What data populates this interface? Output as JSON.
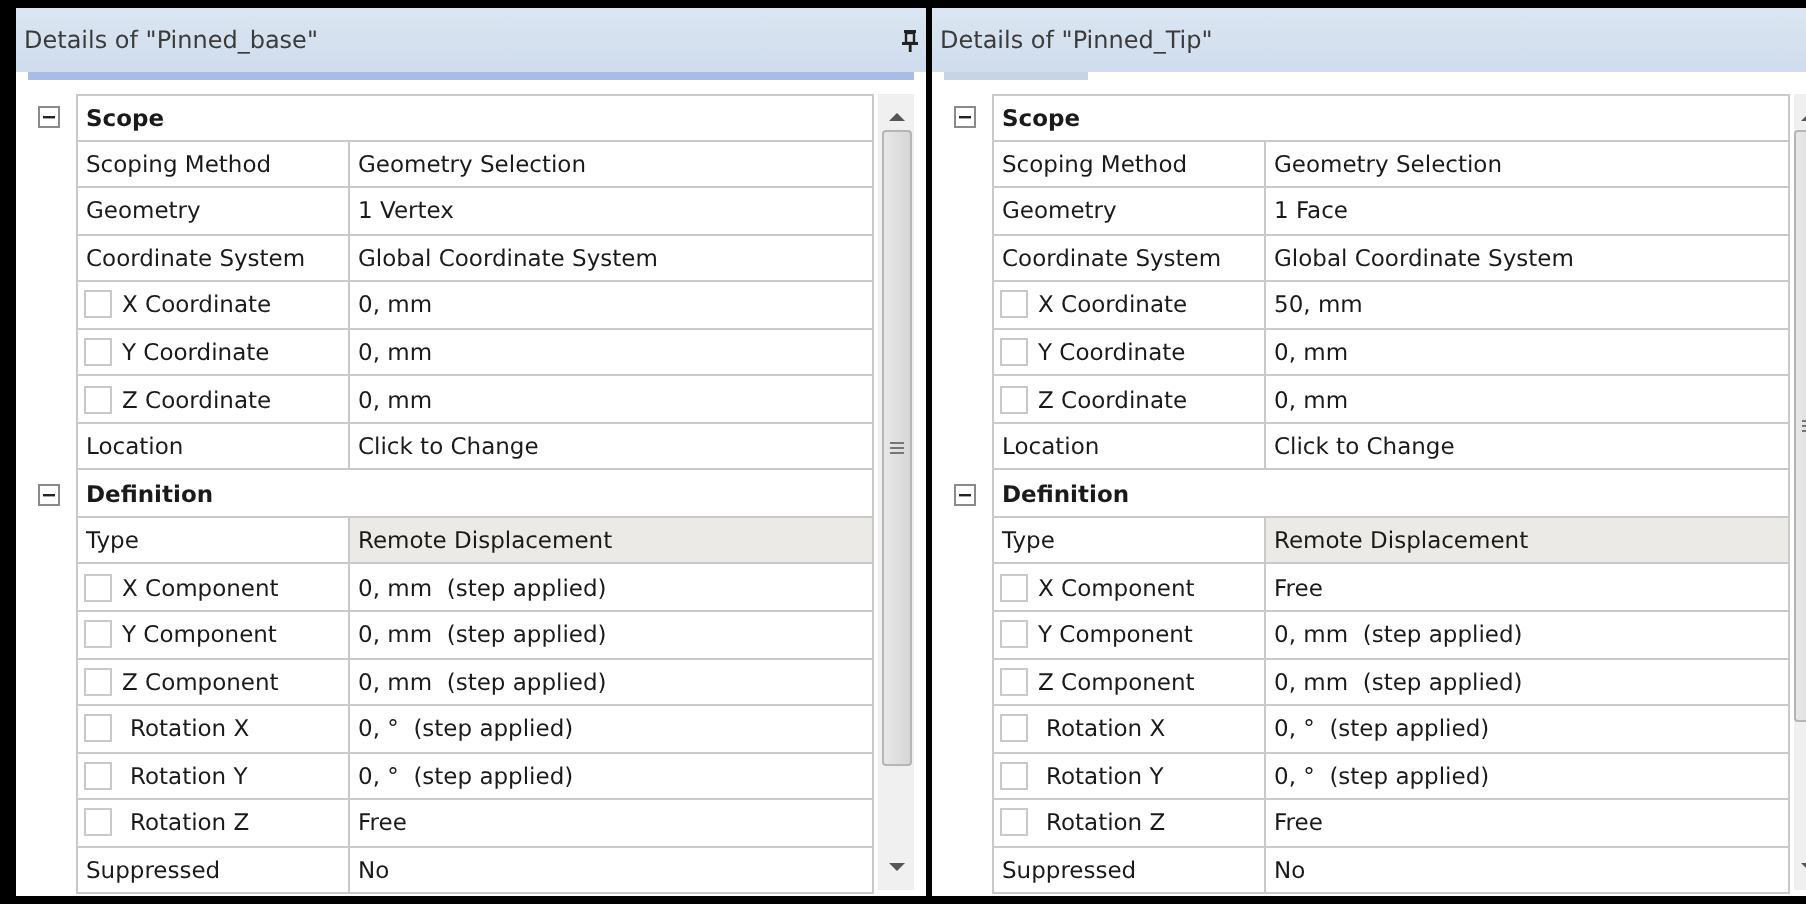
{
  "panels": [
    {
      "title": "Details of \"Pinned_base\"",
      "pinned": true,
      "sections": [
        {
          "label": "Scope",
          "expanded": true,
          "rows": [
            {
              "kind": "plain",
              "name": "Scoping Method",
              "value": "Geometry Selection",
              "shaded": false
            },
            {
              "kind": "plain",
              "name": "Geometry",
              "value": "1 Vertex",
              "shaded": false
            },
            {
              "kind": "plain",
              "name": "Coordinate System",
              "value": "Global Coordinate System",
              "shaded": false
            },
            {
              "kind": "checkbox",
              "name": "X Coordinate",
              "value": "0, mm",
              "shaded": false,
              "checked": false
            },
            {
              "kind": "checkbox",
              "name": "Y Coordinate",
              "value": "0, mm",
              "shaded": false,
              "checked": false
            },
            {
              "kind": "checkbox",
              "name": "Z Coordinate",
              "value": "0, mm",
              "shaded": false,
              "checked": false
            },
            {
              "kind": "plain",
              "name": "Location",
              "value": "Click to Change",
              "shaded": false
            }
          ]
        },
        {
          "label": "Definition",
          "expanded": true,
          "rows": [
            {
              "kind": "plain",
              "name": "Type",
              "value": "Remote Displacement",
              "shaded": true
            },
            {
              "kind": "checkbox",
              "name": "X Component",
              "value": "0, mm  (step applied)",
              "shaded": false,
              "checked": false
            },
            {
              "kind": "checkbox",
              "name": "Y Component",
              "value": "0, mm  (step applied)",
              "shaded": false,
              "checked": false
            },
            {
              "kind": "checkbox",
              "name": "Z Component",
              "value": "0, mm  (step applied)",
              "shaded": false,
              "checked": false
            },
            {
              "kind": "indented",
              "name": "Rotation X",
              "value": "0, °  (step applied)",
              "shaded": false,
              "checked": false
            },
            {
              "kind": "indented",
              "name": "Rotation Y",
              "value": "0, °  (step applied)",
              "shaded": false,
              "checked": false
            },
            {
              "kind": "indented",
              "name": "Rotation Z",
              "value": "Free",
              "shaded": false,
              "checked": false
            },
            {
              "kind": "plain",
              "name": "Suppressed",
              "value": "No",
              "shaded": false
            }
          ]
        }
      ]
    },
    {
      "title": "Details of \"Pinned_Tip\"",
      "pinned": false,
      "sections": [
        {
          "label": "Scope",
          "expanded": true,
          "rows": [
            {
              "kind": "plain",
              "name": "Scoping Method",
              "value": "Geometry Selection",
              "shaded": false
            },
            {
              "kind": "plain",
              "name": "Geometry",
              "value": "1 Face",
              "shaded": false
            },
            {
              "kind": "plain",
              "name": "Coordinate System",
              "value": "Global Coordinate System",
              "shaded": false
            },
            {
              "kind": "checkbox",
              "name": "X Coordinate",
              "value": "50, mm",
              "shaded": false,
              "checked": false
            },
            {
              "kind": "checkbox",
              "name": "Y Coordinate",
              "value": "0, mm",
              "shaded": false,
              "checked": false
            },
            {
              "kind": "checkbox",
              "name": "Z Coordinate",
              "value": "0, mm",
              "shaded": false,
              "checked": false
            },
            {
              "kind": "plain",
              "name": "Location",
              "value": "Click to Change",
              "shaded": false
            }
          ]
        },
        {
          "label": "Definition",
          "expanded": true,
          "rows": [
            {
              "kind": "plain",
              "name": "Type",
              "value": "Remote Displacement",
              "shaded": true
            },
            {
              "kind": "checkbox",
              "name": "X Component",
              "value": "Free",
              "shaded": false,
              "checked": false
            },
            {
              "kind": "checkbox",
              "name": "Y Component",
              "value": "0, mm  (step applied)",
              "shaded": false,
              "checked": false
            },
            {
              "kind": "checkbox",
              "name": "Z Component",
              "value": "0, mm  (step applied)",
              "shaded": false,
              "checked": false
            },
            {
              "kind": "indented",
              "name": "Rotation X",
              "value": "0, °  (step applied)",
              "shaded": false,
              "checked": false
            },
            {
              "kind": "indented",
              "name": "Rotation Y",
              "value": "0, °  (step applied)",
              "shaded": false,
              "checked": false
            },
            {
              "kind": "indented",
              "name": "Rotation Z",
              "value": "Free",
              "shaded": false,
              "checked": false
            },
            {
              "kind": "plain",
              "name": "Suppressed",
              "value": "No",
              "shaded": false
            }
          ]
        }
      ]
    }
  ]
}
